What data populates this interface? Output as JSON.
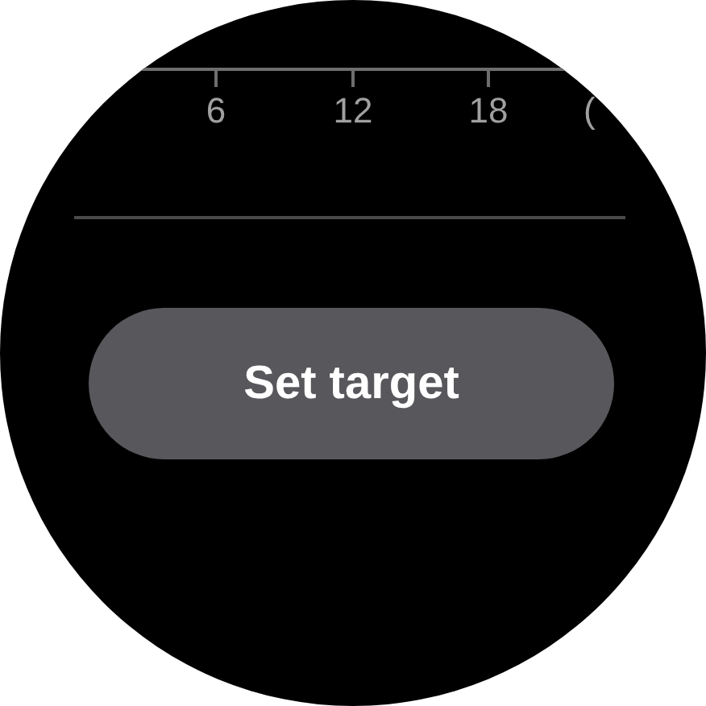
{
  "time_axis": {
    "ticks": [
      "6",
      "12",
      "18"
    ],
    "unit": "("
  },
  "button": {
    "label": "Set target"
  }
}
